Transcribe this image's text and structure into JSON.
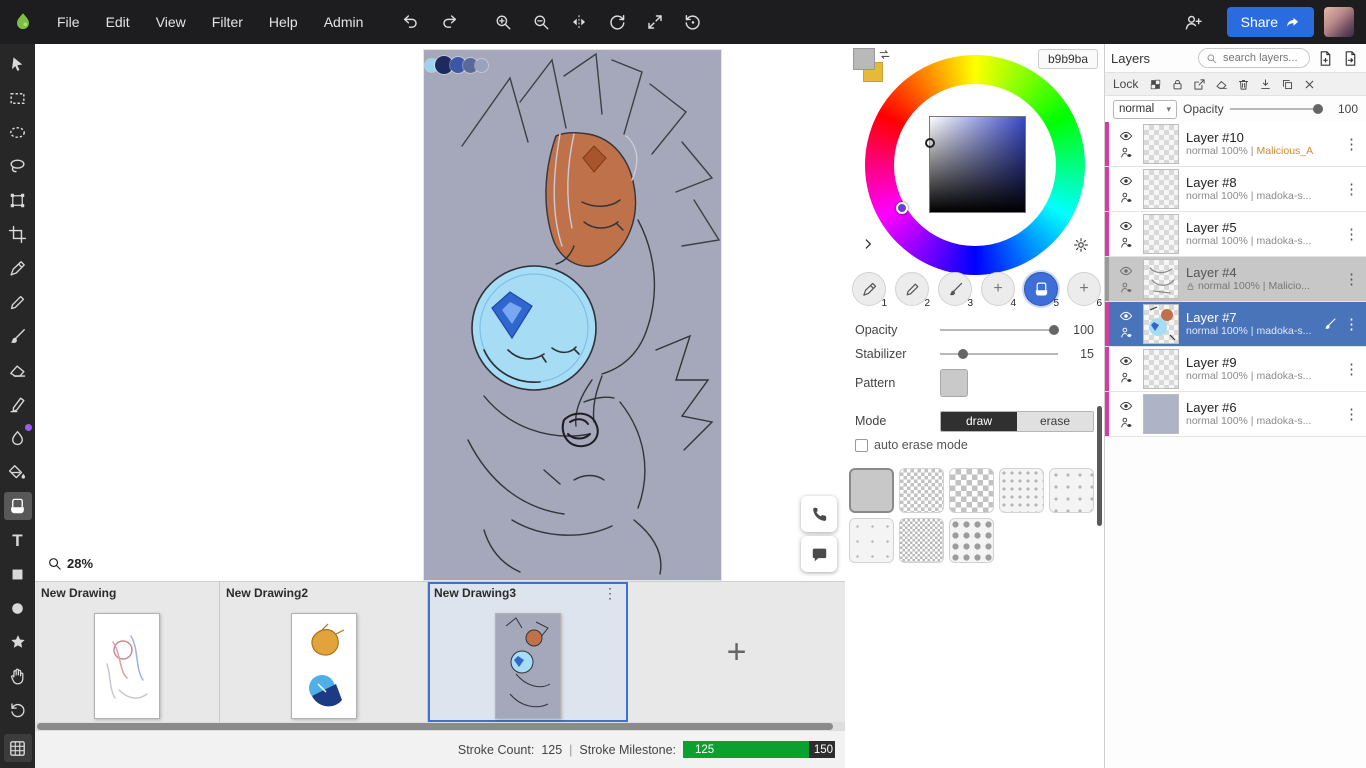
{
  "topbar": {
    "menus": [
      "File",
      "Edit",
      "View",
      "Filter",
      "Help",
      "Admin"
    ],
    "share_label": "Share"
  },
  "icons": {
    "text_tool": "T",
    "dropdown": "▾",
    "menu": "⋮",
    "plus": "+"
  },
  "canvas": {
    "zoom_label": "28%",
    "palette_dots": [
      "#9bd4ee",
      "#1c2a5e",
      "#3d57a8",
      "#5b6899",
      "#9aa3bd"
    ],
    "artboard_color": "#a4a8ba"
  },
  "color_panel": {
    "hex": "b9b9ba",
    "primary_color": "#b9b9ba",
    "secondary_color": "#e6b93d",
    "slot_numbers": [
      "1",
      "2",
      "3",
      "4",
      "5",
      "6"
    ],
    "active_slot": 5,
    "opacity_label": "Opacity",
    "opacity_value": "100",
    "stabilizer_label": "Stabilizer",
    "stabilizer_value": "15",
    "pattern_label": "Pattern",
    "mode_label": "Mode",
    "draw_label": "draw",
    "erase_label": "erase",
    "auto_erase_label": "auto erase mode"
  },
  "layers": {
    "title": "Layers",
    "search_placeholder": "search layers...",
    "lock_label": "Lock",
    "blend_mode": "normal",
    "opacity_label": "Opacity",
    "opacity_value": "100",
    "accent_strip_color": "#da3b9f",
    "selected_bg_color": "#4a74ba",
    "items": [
      {
        "name": "Layer #10",
        "blend": "normal 100% |",
        "author": "Malicious_A",
        "selected": false,
        "dimmed": false
      },
      {
        "name": "Layer #8",
        "blend": "normal 100% |",
        "author": "madoka-s...",
        "selected": false,
        "dimmed": false
      },
      {
        "name": "Layer #5",
        "blend": "normal 100% |",
        "author": "madoka-s...",
        "selected": false,
        "dimmed": false
      },
      {
        "name": "Layer #4",
        "blend": "normal 100% |",
        "author": "Malicio...",
        "selected": false,
        "dimmed": true,
        "locked": true
      },
      {
        "name": "Layer #7",
        "blend": "normal 100% |",
        "author": "madoka-s...",
        "selected": true,
        "dimmed": false
      },
      {
        "name": "Layer #9",
        "blend": "normal 100% |",
        "author": "madoka-s...",
        "selected": false,
        "dimmed": false
      },
      {
        "name": "Layer #6",
        "blend": "normal 100% |",
        "author": "madoka-s...",
        "selected": false,
        "dimmed": false
      }
    ]
  },
  "tabs": {
    "items": [
      {
        "label": "New Drawing",
        "selected": false
      },
      {
        "label": "New Drawing2",
        "selected": false
      },
      {
        "label": "New Drawing3",
        "selected": true
      }
    ],
    "add_label": "+"
  },
  "statusbar": {
    "stroke_label": "Stroke Count:",
    "stroke_value": "125",
    "divider": "|",
    "milestone_label": "Stroke Milestone:",
    "milestone_value": "125",
    "milestone_max": "150",
    "progress_color": "#0aa12e"
  }
}
